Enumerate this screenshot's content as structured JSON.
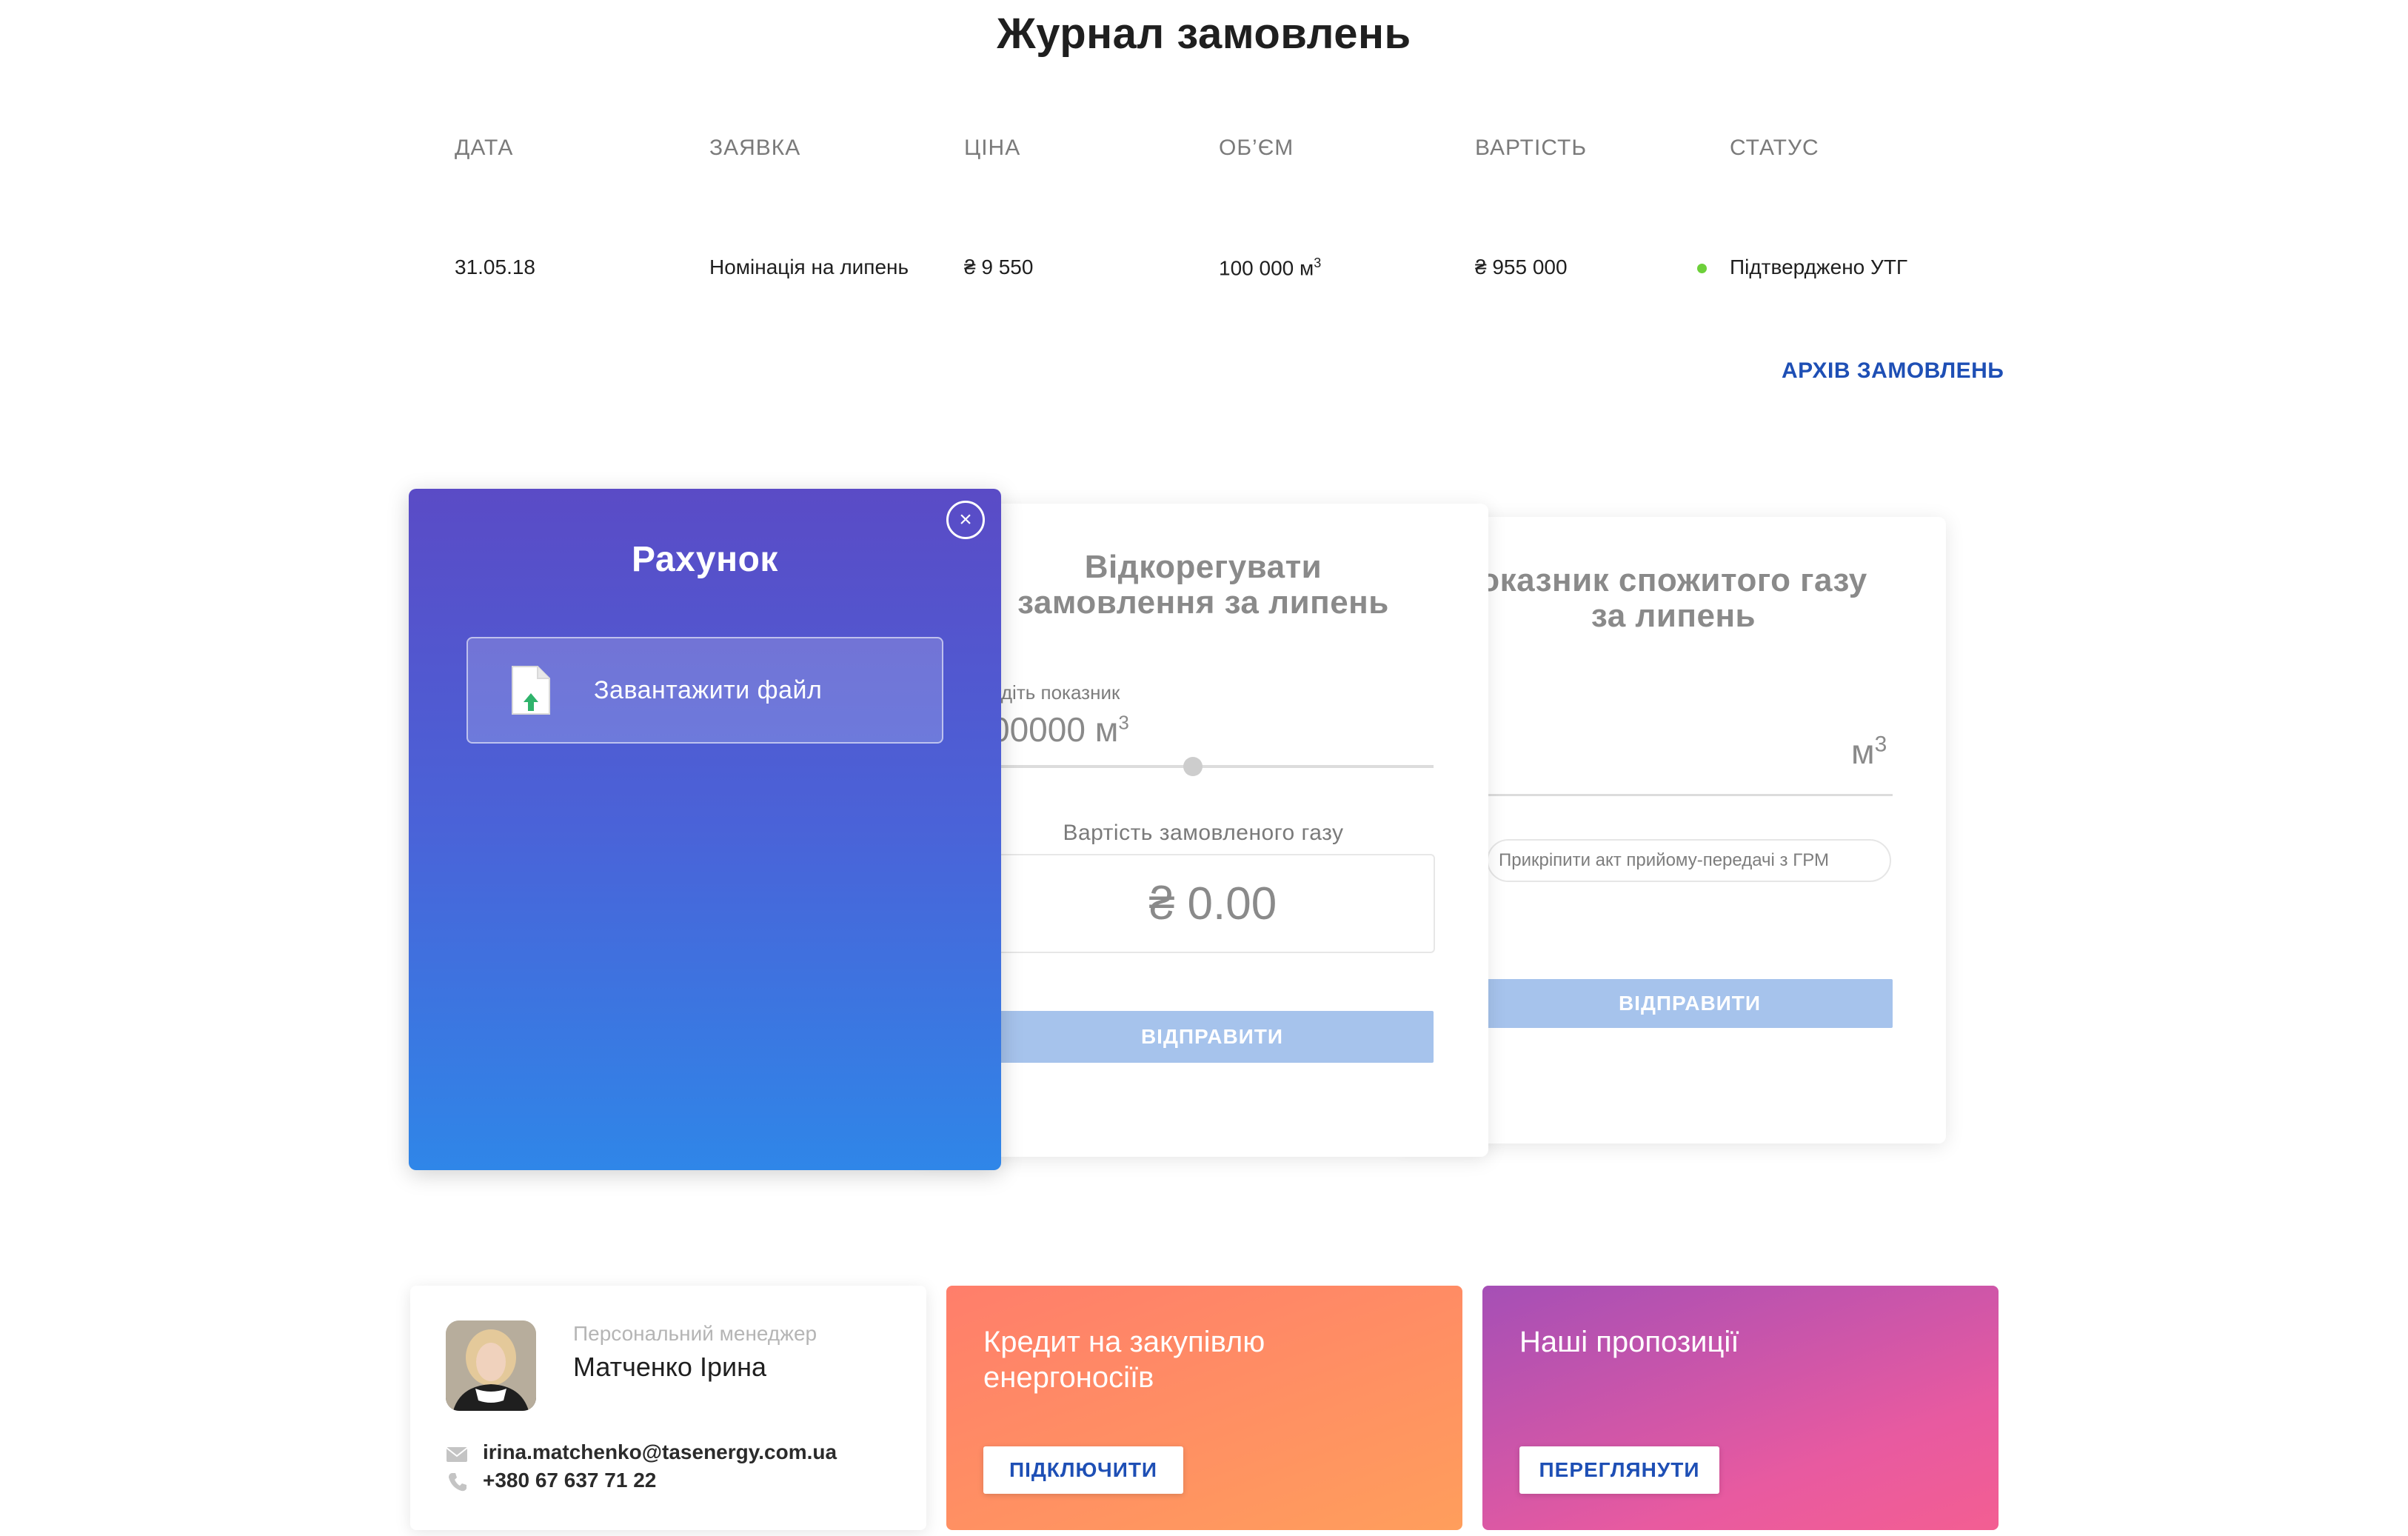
{
  "page": {
    "title": "Журнал замовлень"
  },
  "table": {
    "headers": [
      "ДАТА",
      "ЗАЯВКА",
      "ЦІНА",
      "ОБ’ЄМ",
      "ВАРТІСТЬ",
      "СТАТУС"
    ],
    "rows": [
      {
        "date": "31.05.18",
        "request": "Номінація на липень",
        "price": "₴ 9 550",
        "volume": "100 000 м",
        "volume_sup": "3",
        "cost": "₴ 955 000",
        "status": "Підтверджено УТГ",
        "status_color": "#6dd03a"
      }
    ],
    "archive_link": "АРХІВ ЗАМОВЛЕНЬ"
  },
  "adjust_card": {
    "title_line1": "Відкорегувати",
    "title_line2": "замовлення за липень",
    "field_label": "едіть показник",
    "field_value": "00000 м",
    "field_value_sup": "3",
    "cost_label": "Вартість замовленого газу",
    "cost_value": "₴ 0.00",
    "send_label": "ВІДПРАВИТИ"
  },
  "meter_card": {
    "title_line1": "оказник спожитого газу",
    "title_line2": "за липень",
    "unit": "м",
    "unit_sup": "3",
    "attach_label": "Прикріпити акт прийому-передачі з ГРМ",
    "send_label": "ВІДПРАВИТИ"
  },
  "invoice_panel": {
    "title": "Рахунок",
    "close_symbol": "×",
    "upload_label": "Завантажити файл",
    "upload_icon": "file-upload-icon"
  },
  "manager": {
    "role": "Персональний менеджер",
    "name": "Матченко Ірина",
    "email": "irina.matchenko@tasenergy.com.ua",
    "phone": "+380 67 637 71 22"
  },
  "credit": {
    "title_line1": "Кредит на закупівлю",
    "title_line2": "енергоносіїв",
    "button": "ПІДКЛЮЧИТИ"
  },
  "offers": {
    "title": "Наші пропозиції",
    "button": "ПЕРЕГЛЯНУТИ"
  },
  "colors": {
    "accent_link": "#1e4fb5",
    "send_button": "#a6c3ec",
    "panel_gradient_top": "#5a4bc6",
    "panel_gradient_bottom": "#2f86e8",
    "credit_gradient": "#ff7e6b",
    "offers_gradient": "#a54fb6"
  }
}
